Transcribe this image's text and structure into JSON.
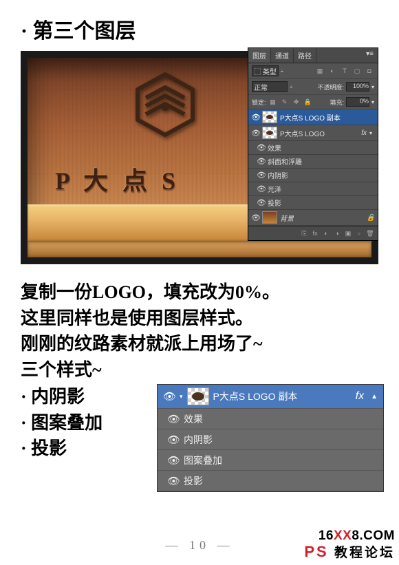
{
  "title": "· 第三个图层",
  "mockup_text": "P 大 点 S",
  "panel1": {
    "tabs": [
      "图层",
      "通道",
      "路径"
    ],
    "kind_label": "⬚ 类型",
    "blend": "正常",
    "opacity_label": "不透明度:",
    "opacity_value": "100%",
    "lock_label": "锁定:",
    "fill_label": "填充:",
    "fill_value": "0%",
    "layers": [
      {
        "name": "P大点S LOGO 副本",
        "selected": true
      },
      {
        "name": "P大点S LOGO",
        "fx": "fx"
      }
    ],
    "effects_heading": "效果",
    "effects": [
      "斜面和浮雕",
      "内阴影",
      "光泽",
      "投影"
    ],
    "background": "背景"
  },
  "body": {
    "l1": "复制一份LOGO，填充改为0%。",
    "l2": "这里同样也是使用图层样式。",
    "l3": "刚刚的纹路素材就派上用场了~",
    "l4": "三个样式~",
    "s1": "· 内阴影",
    "s2": "· 图案叠加",
    "s3": "· 投影"
  },
  "panel2": {
    "layer_name": "P大点S LOGO 副本",
    "fx": "fx",
    "effects_heading": "效果",
    "effects": [
      "内阴影",
      "图案叠加",
      "投影"
    ]
  },
  "page_number": "10",
  "watermark": {
    "line1_a": "16",
    "line1_b": "XX",
    "line1_c": "8.COM",
    "line2_a": "PS",
    "line2_b": "教程论坛"
  }
}
